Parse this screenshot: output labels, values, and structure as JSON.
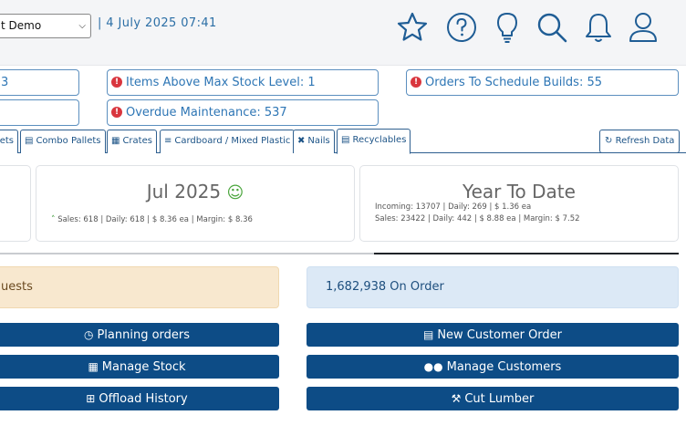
{
  "header": {
    "company_select_value": "t Demo",
    "datetime": "| 4 July 2025 07:41",
    "icons": [
      "star-icon",
      "help-icon",
      "lightbulb-icon",
      "search-icon",
      "bell-icon",
      "user-icon"
    ]
  },
  "alerts": {
    "left_top": "3",
    "max_stock": "Items Above Max Stock Level: 1",
    "schedule_builds": "Orders To Schedule Builds: 55",
    "overdue_maintenance": "Overdue Maintenance: 537"
  },
  "tabs": [
    {
      "label": "lets",
      "icon": ""
    },
    {
      "label": "Combo Pallets",
      "icon": "pallet-icon"
    },
    {
      "label": "Crates",
      "icon": "crate-icon"
    },
    {
      "label": "Cardboard / Mixed Plastic",
      "icon": "list-icon"
    },
    {
      "label": "Nails",
      "icon": "tools-icon"
    },
    {
      "label": "Recyclables",
      "icon": "pallet-icon"
    }
  ],
  "refresh_label": "Refresh Data",
  "month_card": {
    "title": "Jul 2025",
    "stats": "Sales: 618 | Daily: 618 | $ 8.36 ea | Margin: $ 8.36"
  },
  "ytd_card": {
    "title": "Year To Date",
    "incoming": "Incoming: 13707 | Daily: 269 | $ 1.36 ea",
    "sales": "Sales: 23422 | Daily: 442 | $ 8.88 ea | Margin: $ 7.52"
  },
  "requests_text": "uests",
  "on_order_text": "1,682,938 On Order",
  "buttons": {
    "planning_orders": "Planning orders",
    "manage_stock": "Manage Stock",
    "offload_history": "Offload History",
    "new_customer_order": "New Customer Order",
    "manage_customers": "Manage Customers",
    "cut_lumber": "Cut Lumber"
  },
  "colors": {
    "primary_button": "#0d4c86",
    "link_blue": "#2e76b5",
    "alert_red": "#d9363e",
    "success_green": "#4aa53c",
    "warning_panel": "#f8e8cf",
    "info_panel": "#dce9f6"
  }
}
